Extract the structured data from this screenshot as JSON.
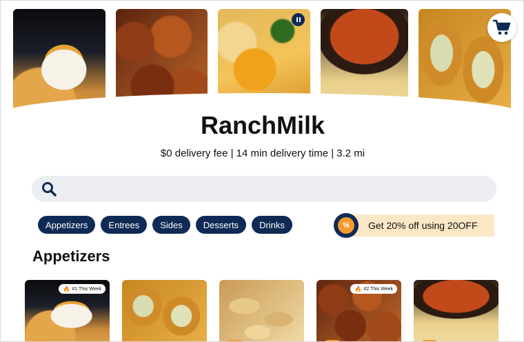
{
  "restaurant": {
    "name": "RanchMilk",
    "delivery_info": "$0 delivery fee | 14 min delivery time | 3.2 mi"
  },
  "hero_images": [
    {
      "name": "queso-dip"
    },
    {
      "name": "chicken-wings"
    },
    {
      "name": "loaded-nachos"
    },
    {
      "name": "salsa-and-chips"
    },
    {
      "name": "jalapeno-poppers"
    }
  ],
  "header": {
    "cart_icon": "shopping-cart-icon",
    "pause_icon": "pause-icon"
  },
  "search": {
    "icon": "search-icon",
    "placeholder": "",
    "value": ""
  },
  "categories": [
    "Appetizers",
    "Entrees",
    "Sides",
    "Desserts",
    "Drinks"
  ],
  "promo": {
    "icon": "percent-badge-icon",
    "badge_symbol": "%",
    "text": "Get 20% off using 20OFF"
  },
  "section": {
    "title": "Appetizers"
  },
  "menu_cards": [
    {
      "image": "queso-dip",
      "badge": "#1 This Week"
    },
    {
      "image": "jalapeno-poppers",
      "badge": ""
    },
    {
      "image": "tortilla-chips",
      "badge": ""
    },
    {
      "image": "chicken-wings",
      "badge": "#2 This Week"
    },
    {
      "image": "salsa-and-chips",
      "badge": ""
    }
  ],
  "colors": {
    "primary": "#0f2a55",
    "accent": "#f39a2b",
    "promo_bg": "#fbe6c6",
    "search_bg": "#eceef2"
  }
}
